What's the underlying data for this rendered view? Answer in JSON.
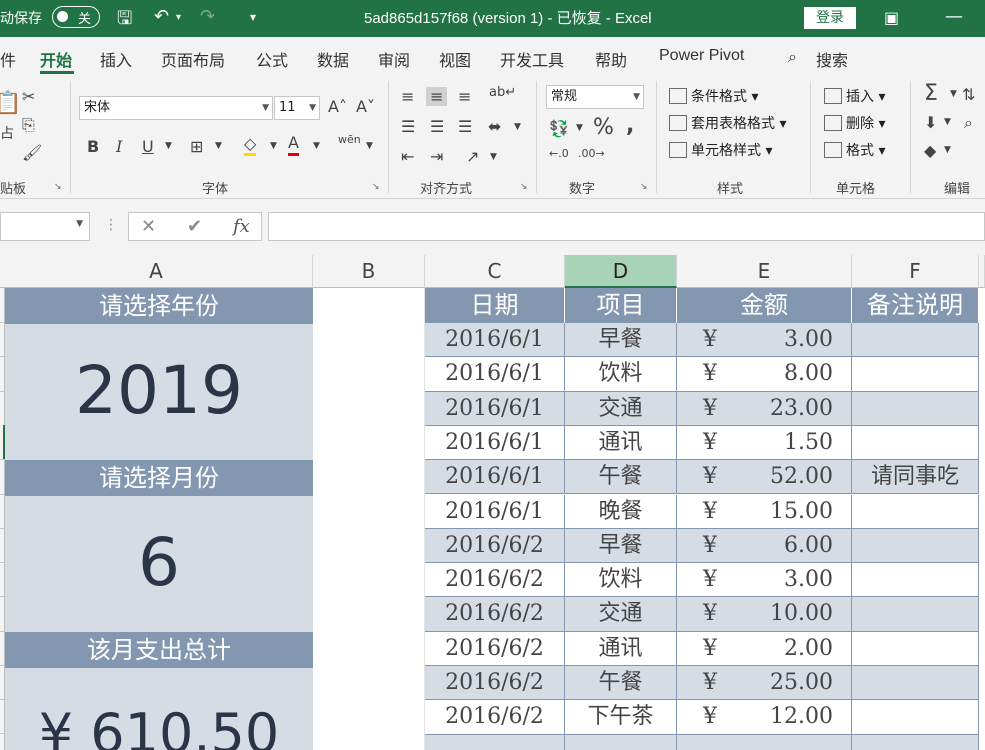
{
  "titlebar": {
    "autosave_label": "动保存",
    "autosave_state": "关",
    "title": "5ad865d157f68 (version 1)  -  已恢复  -  Excel",
    "login": "登录"
  },
  "tabs": [
    "件",
    "开始",
    "插入",
    "页面布局",
    "公式",
    "数据",
    "审阅",
    "视图",
    "开发工具",
    "帮助",
    "Power Pivot",
    "搜索"
  ],
  "ribbon": {
    "clipboard_label": "贴板",
    "paste_label": "占",
    "font_name": "宋体",
    "font_size": "11",
    "font_label": "字体",
    "bold": "B",
    "italic": "I",
    "underline": "U",
    "align_label": "对齐方式",
    "number_format": "常规",
    "number_label": "数字",
    "percent": "%",
    "comma": ",",
    "cond_format": "条件格式",
    "table_format": "套用表格格式",
    "cell_style": "单元格样式",
    "styles_label": "样式",
    "insert": "插入",
    "delete": "删除",
    "format": "格式",
    "cells_label": "单元格",
    "edit_label": "编辑"
  },
  "formula": {
    "fx": "fx",
    "value": ""
  },
  "columns": [
    "A",
    "B",
    "C",
    "D",
    "E",
    "F"
  ],
  "left_panel": {
    "year_label": "请选择年份",
    "year_value": "2019",
    "month_label": "请选择月份",
    "month_value": "6",
    "total_label": "该月支出总计",
    "total_value": "¥ 610.50"
  },
  "table": {
    "headers": [
      "日期",
      "项目",
      "金额",
      "备注说明"
    ],
    "currency": "¥",
    "rows": [
      {
        "date": "2016/6/1",
        "item": "早餐",
        "amount": "3.00",
        "note": ""
      },
      {
        "date": "2016/6/1",
        "item": "饮料",
        "amount": "8.00",
        "note": ""
      },
      {
        "date": "2016/6/1",
        "item": "交通",
        "amount": "23.00",
        "note": ""
      },
      {
        "date": "2016/6/1",
        "item": "通讯",
        "amount": "1.50",
        "note": ""
      },
      {
        "date": "2016/6/1",
        "item": "午餐",
        "amount": "52.00",
        "note": "请同事吃"
      },
      {
        "date": "2016/6/1",
        "item": "晚餐",
        "amount": "15.00",
        "note": ""
      },
      {
        "date": "2016/6/2",
        "item": "早餐",
        "amount": "6.00",
        "note": ""
      },
      {
        "date": "2016/6/2",
        "item": "饮料",
        "amount": "3.00",
        "note": ""
      },
      {
        "date": "2016/6/2",
        "item": "交通",
        "amount": "10.00",
        "note": ""
      },
      {
        "date": "2016/6/2",
        "item": "通讯",
        "amount": "2.00",
        "note": ""
      },
      {
        "date": "2016/6/2",
        "item": "午餐",
        "amount": "25.00",
        "note": ""
      },
      {
        "date": "2016/6/2",
        "item": "下午茶",
        "amount": "12.00",
        "note": ""
      }
    ]
  }
}
